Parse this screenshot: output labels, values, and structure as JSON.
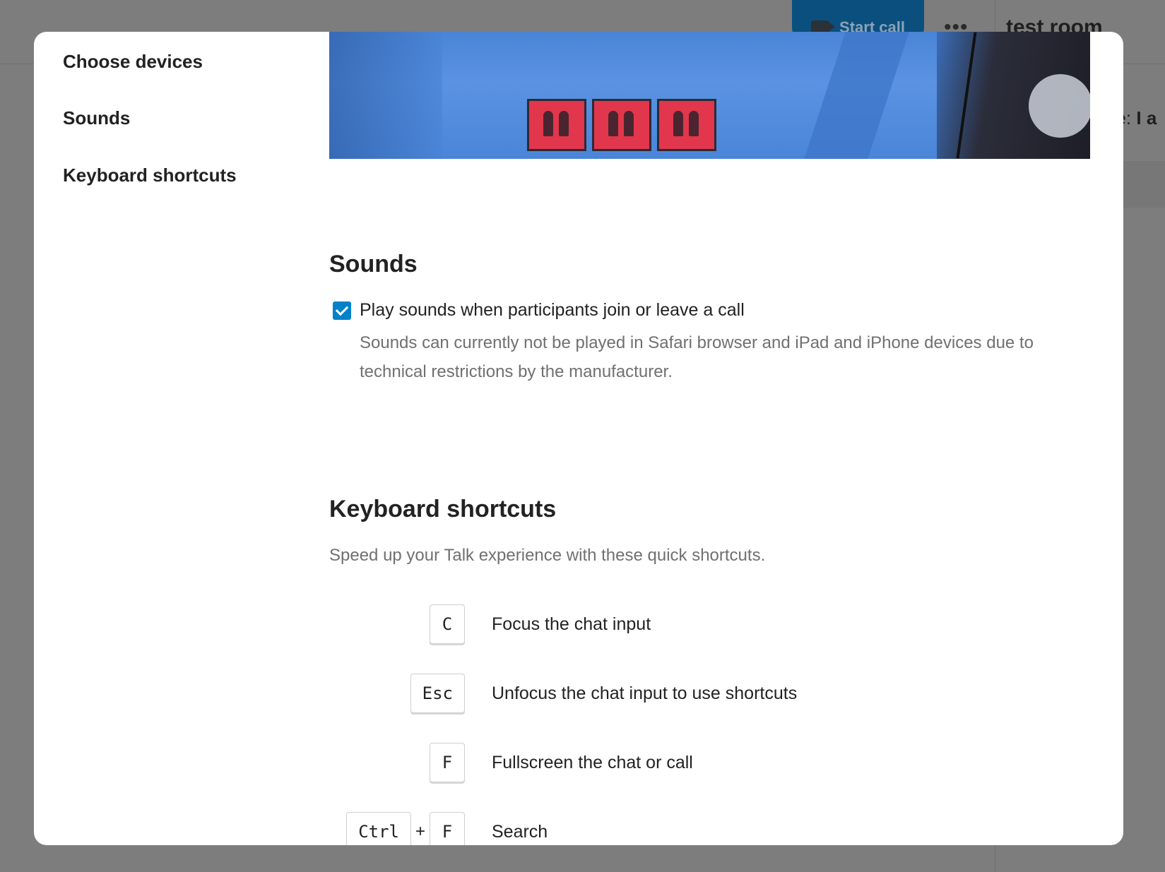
{
  "background": {
    "start_call_label": "Start call",
    "more_label": "•••",
    "room_title": "test room",
    "right_snippet_prefix": "ne:",
    "right_snippet_bold": "I a"
  },
  "nav": {
    "items": [
      {
        "label": "Choose devices"
      },
      {
        "label": "Sounds"
      },
      {
        "label": "Keyboard shortcuts"
      }
    ]
  },
  "sounds": {
    "heading": "Sounds",
    "checkbox_label": "Play sounds when participants join or leave a call",
    "checkbox_checked": true,
    "hint": "Sounds can currently not be played in Safari browser and iPad and iPhone devices due to technical restrictions by the manufacturer."
  },
  "shortcuts": {
    "heading": "Keyboard shortcuts",
    "subtitle": "Speed up your Talk experience with these quick shortcuts.",
    "items": [
      {
        "keys": [
          "C"
        ],
        "label": "Focus the chat input"
      },
      {
        "keys": [
          "Esc"
        ],
        "label": "Unfocus the chat input to use shortcuts"
      },
      {
        "keys": [
          "F"
        ],
        "label": "Fullscreen the chat or call"
      },
      {
        "keys": [
          "Ctrl",
          "F"
        ],
        "label": "Search"
      }
    ],
    "plus": "+"
  },
  "colors": {
    "accent": "#0082c9",
    "overlay": "#7d7d7d",
    "text_primary": "#222222",
    "text_secondary": "#707070"
  }
}
